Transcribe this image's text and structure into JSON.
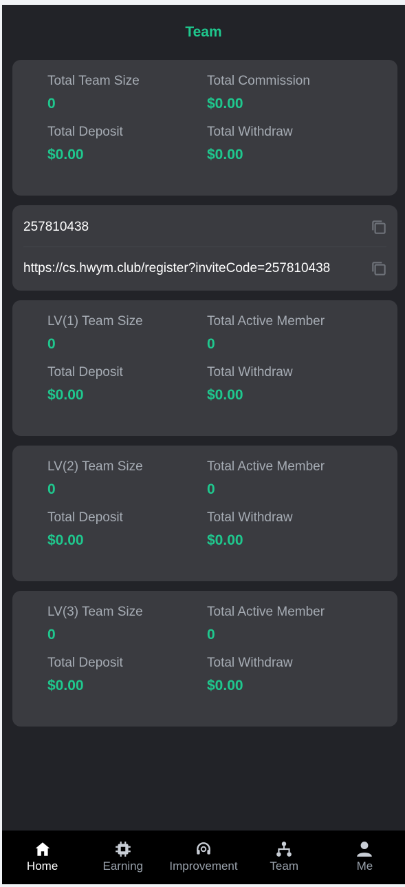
{
  "header": {
    "title": "Team"
  },
  "summary": {
    "team_size_label": "Total Team Size",
    "team_size": "0",
    "commission_label": "Total Commission",
    "commission": "$0.00",
    "deposit_label": "Total Deposit",
    "deposit": "$0.00",
    "withdraw_label": "Total Withdraw",
    "withdraw": "$0.00"
  },
  "invite": {
    "code": "257810438",
    "link": "https://cs.hwym.club/register?inviteCode=257810438"
  },
  "levels": [
    {
      "size_label": "LV(1) Team Size",
      "size": "0",
      "active_label": "Total Active Member",
      "active": "0",
      "deposit_label": "Total Deposit",
      "deposit": "$0.00",
      "withdraw_label": "Total Withdraw",
      "withdraw": "$0.00"
    },
    {
      "size_label": "LV(2) Team Size",
      "size": "0",
      "active_label": "Total Active Member",
      "active": "0",
      "deposit_label": "Total Deposit",
      "deposit": "$0.00",
      "withdraw_label": "Total Withdraw",
      "withdraw": "$0.00"
    },
    {
      "size_label": "LV(3) Team Size",
      "size": "0",
      "active_label": "Total Active Member",
      "active": "0",
      "deposit_label": "Total Deposit",
      "deposit": "$0.00",
      "withdraw_label": "Total Withdraw",
      "withdraw": "$0.00"
    }
  ],
  "nav": {
    "items": [
      {
        "label": "Home",
        "icon": "home-icon",
        "active": true
      },
      {
        "label": "Earning",
        "icon": "chip-icon",
        "active": false
      },
      {
        "label": "Improvement",
        "icon": "headset-icon",
        "active": false
      },
      {
        "label": "Team",
        "icon": "team-tree-icon",
        "active": false
      },
      {
        "label": "Me",
        "icon": "user-icon",
        "active": false
      }
    ]
  },
  "colors": {
    "accent": "#1fc88e",
    "background": "#222328",
    "card": "#3a3b40",
    "nav_bg": "#000000"
  }
}
